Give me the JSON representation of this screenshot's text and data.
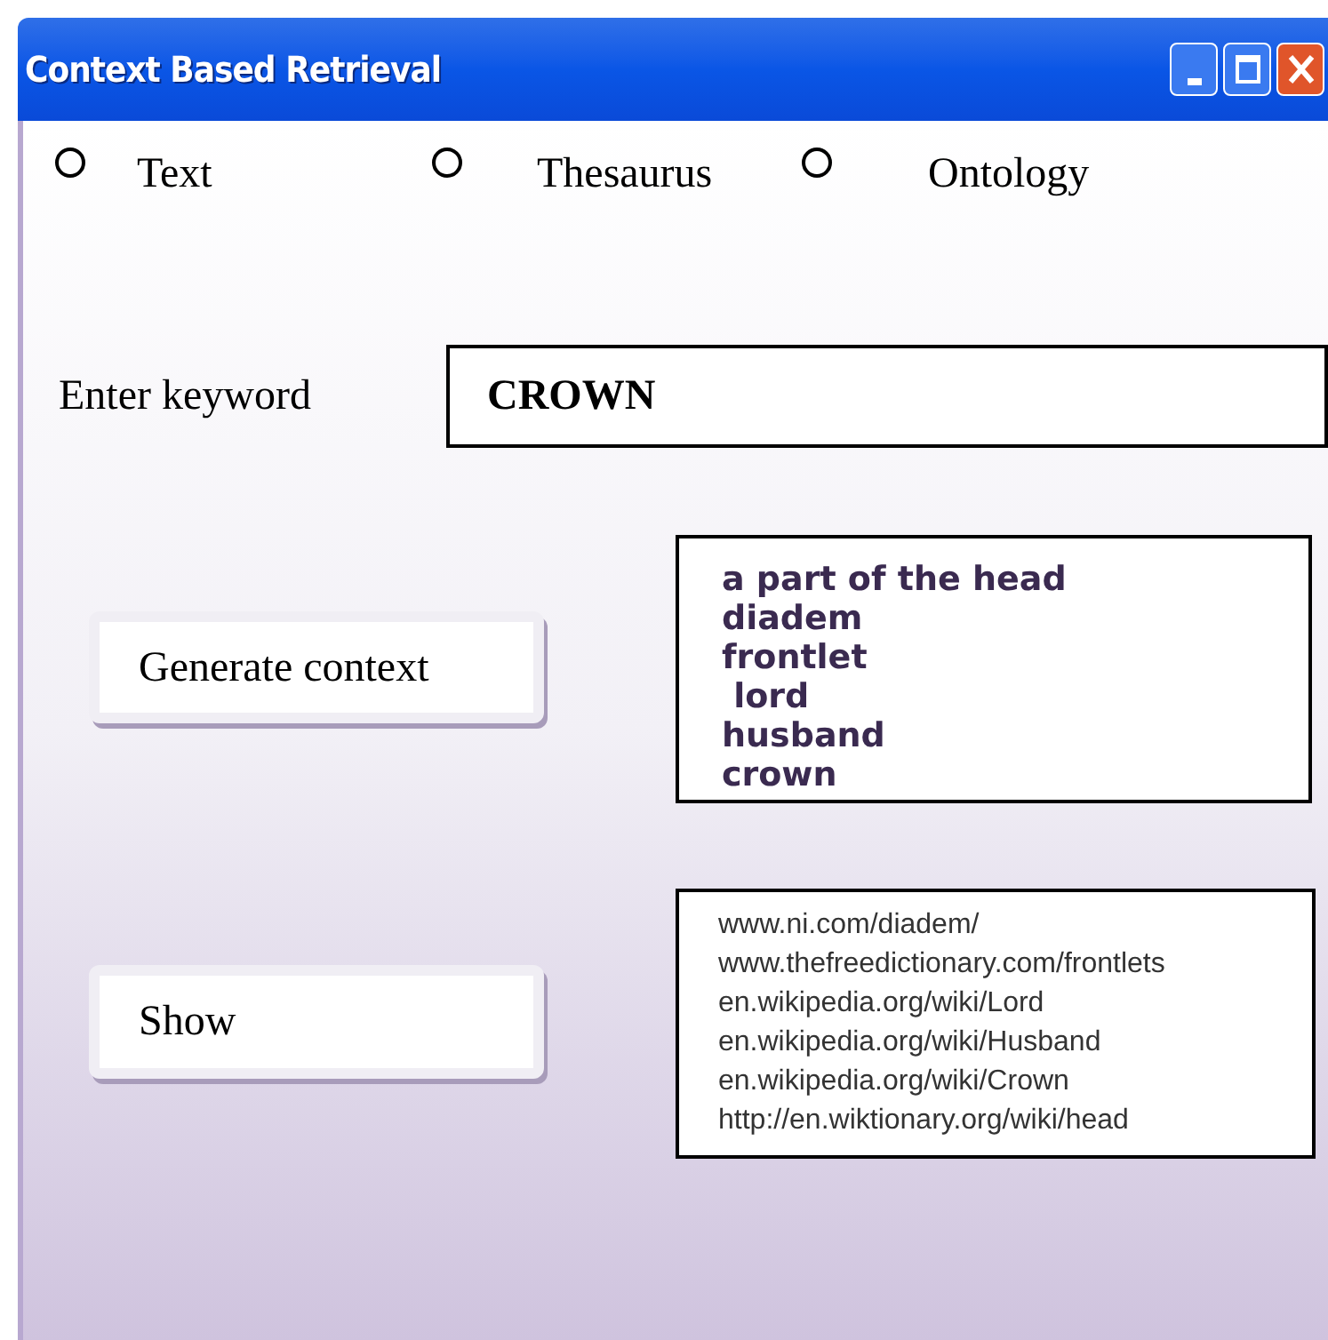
{
  "window": {
    "title": "Context Based Retrieval"
  },
  "search_types": [
    {
      "label": "Text",
      "selected": false
    },
    {
      "label": "Thesaurus",
      "selected": false
    },
    {
      "label": "Ontology",
      "selected": false
    }
  ],
  "keyword": {
    "label": "Enter keyword",
    "value": "CROWN"
  },
  "generate_button": "Generate context",
  "context_list": [
    "a part of the head",
    "diadem",
    "frontlet",
    " lord",
    "husband",
    "crown"
  ],
  "show_button": "Show",
  "url_list": [
    "www.ni.com/diadem/",
    "www.thefreedictionary.com/frontlets",
    "en.wikipedia.org/wiki/Lord",
    "en.wikipedia.org/wiki/Husband",
    "en.wikipedia.org/wiki/Crown",
    "http://en.wiktionary.org/wiki/head"
  ]
}
